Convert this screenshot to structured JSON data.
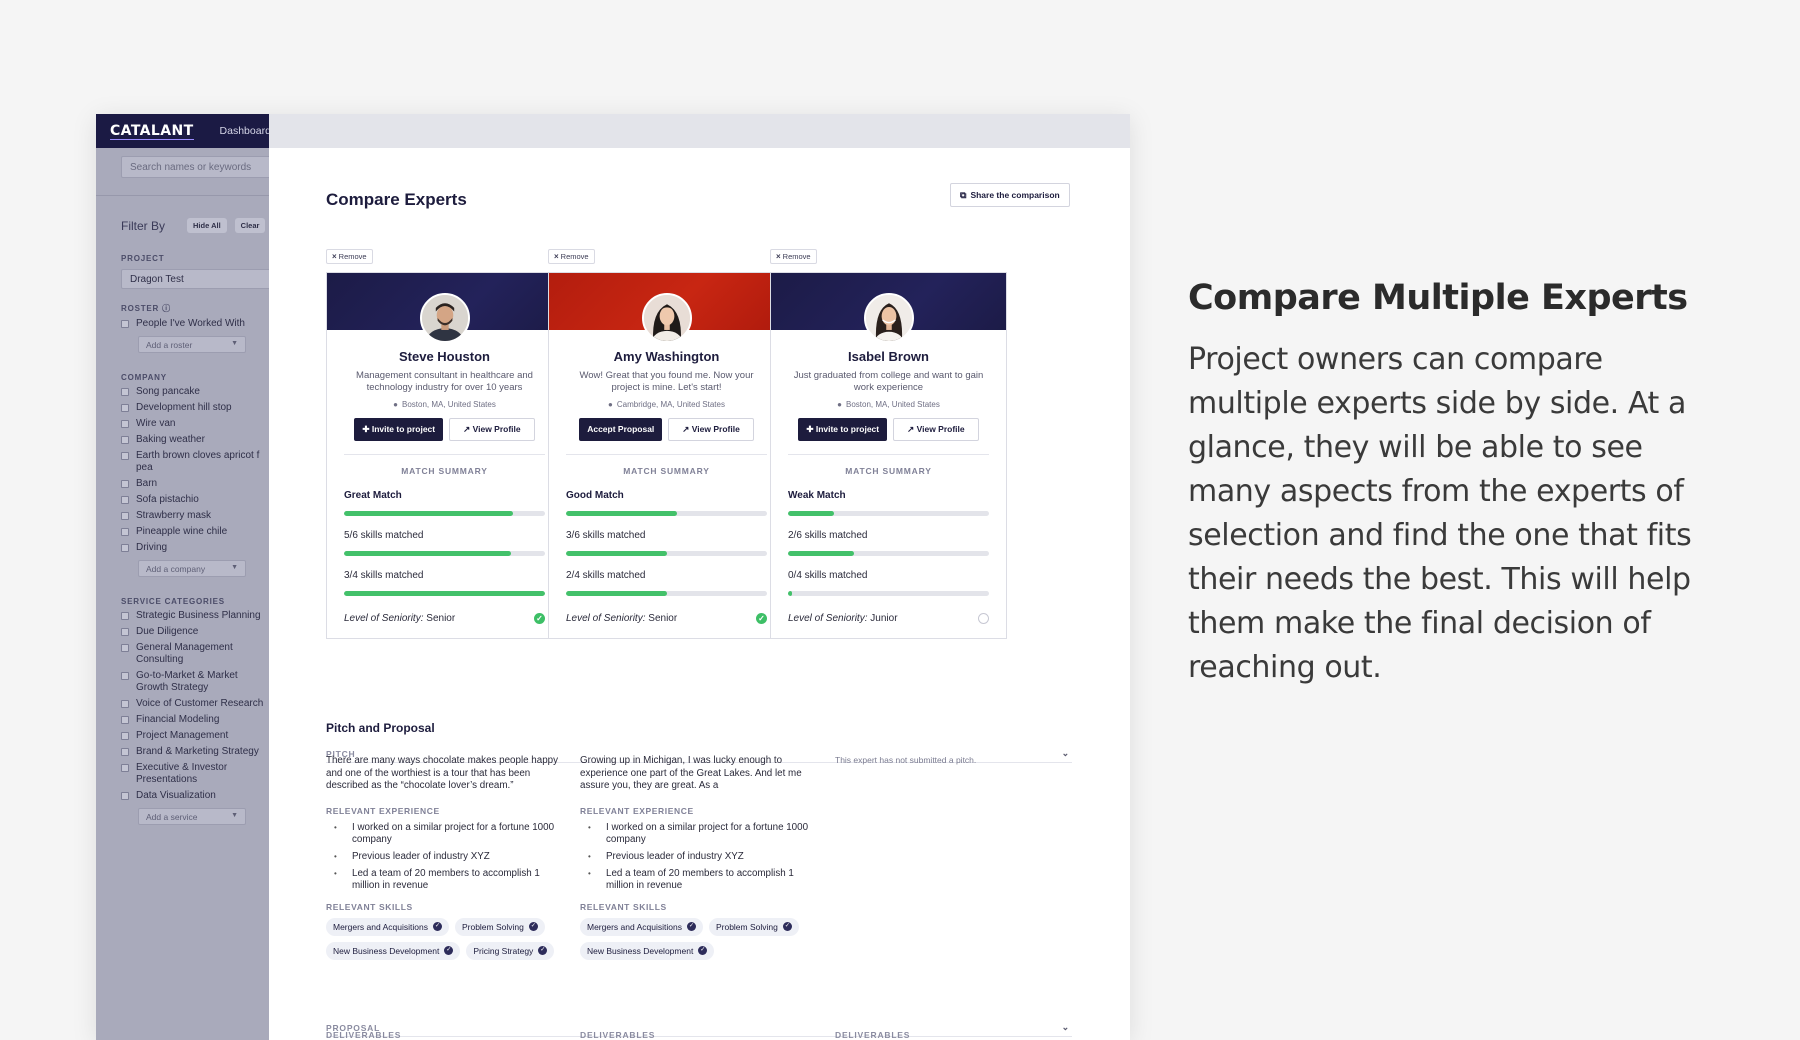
{
  "promo": {
    "title": "Compare Multiple Experts",
    "body": "Project owners can compare multiple experts side by side. At a glance, they will be able to see many aspects from the experts of selection and find the one that fits their needs the best. This will help them make the final decision of reaching out."
  },
  "app": {
    "logo": "CATALANT",
    "nav_dashboard": "Dashboard",
    "search_placeholder": "Search names or keywords"
  },
  "sidebar": {
    "filter_by": "Filter By",
    "hide_all": "Hide All",
    "clear": "Clear",
    "project_label": "PROJECT",
    "project_value": "Dragon Test",
    "roster_label": "ROSTER",
    "roster_items": [
      "People I've Worked With"
    ],
    "roster_add": "Add a roster",
    "company_label": "COMPANY",
    "company_items": [
      "Song pancake",
      "Development hill stop",
      "Wire van",
      "Baking weather",
      "Earth brown cloves apricot f pea",
      "Barn",
      "Sofa pistachio",
      "Strawberry mask",
      "Pineapple wine chile",
      "Driving"
    ],
    "company_add": "Add a company",
    "service_label": "SERVICE CATEGORIES",
    "service_items": [
      "Strategic Business Planning",
      "Due Diligence",
      "General Management Consulting",
      "Go-to-Market & Market Growth Strategy",
      "Voice of Customer Research",
      "Financial Modeling",
      "Project Management",
      "Brand & Marketing Strategy",
      "Executive & Investor Presentations",
      "Data Visualization"
    ],
    "service_add": "Add a service"
  },
  "main": {
    "title": "Compare Experts",
    "share_label": "Share the comparison",
    "remove_label": "Remove",
    "match_summary_label": "MATCH SUMMARY",
    "seniority_label": "Level of Seniority:"
  },
  "experts": [
    {
      "name": "Steve Houston",
      "bio": "Management consultant in healthcare and technology industry for over 10 years",
      "location": "Boston, MA, United States",
      "primary_action": "Invite to project",
      "secondary_action": "View Profile",
      "match_label": "Great Match",
      "match_level": 0.84,
      "skills1_label": "5/6 skills matched",
      "skills1_ratio": 0.83,
      "skills2_label": "3/4 skills matched",
      "skills2_ratio": 1.0,
      "seniority": "Senior",
      "seniority_met": true,
      "banner": "navy"
    },
    {
      "name": "Amy Washington",
      "bio": "Wow! Great that you found me. Now your project is mine. Let's start!",
      "location": "Cambridge, MA, United States",
      "primary_action": "Accept Proposal",
      "secondary_action": "View Profile",
      "match_label": "Good Match",
      "match_level": 0.55,
      "skills1_label": "3/6 skills matched",
      "skills1_ratio": 0.5,
      "skills2_label": "2/4 skills matched",
      "skills2_ratio": 0.5,
      "seniority": "Senior",
      "seniority_met": true,
      "banner": "red"
    },
    {
      "name": "Isabel Brown",
      "bio": "Just graduated from college and want to gain work experience",
      "location": "Boston, MA, United States",
      "primary_action": "Invite to project",
      "secondary_action": "View Profile",
      "match_label": "Weak Match",
      "match_level": 0.23,
      "skills1_label": "2/6 skills matched",
      "skills1_ratio": 0.33,
      "skills2_label": "0/4 skills matched",
      "skills2_ratio": 0.02,
      "seniority": "Junior",
      "seniority_met": false,
      "banner": "navy"
    }
  ],
  "pitch": {
    "section_title": "Pitch and Proposal",
    "pitch_label": "PITCH",
    "proposal_label": "PROPOSAL",
    "deliverables_label": "DELIVERABLES",
    "relevant_experience_label": "RELEVANT EXPERIENCE",
    "relevant_skills_label": "RELEVANT SKILLS",
    "col1_text": "There are many ways chocolate makes people happy and one of the worthiest is a tour that has been described as the “chocolate lover’s dream.”",
    "col2_text": "Growing up in Michigan, I was lucky enough to experience one part of the Great Lakes. And let me assure you, they are great. As a",
    "col3_text": "This expert has not submitted a pitch.",
    "experience": [
      "I worked on a similar project for a fortune 1000 company",
      "Previous leader of industry XYZ",
      "Led a team of 20 members to accomplish 1 million in revenue"
    ],
    "col1_skills": [
      "Mergers and Acquisitions",
      "Problem Solving",
      "New Business Development",
      "Pricing Strategy"
    ],
    "col2_skills": [
      "Mergers and Acquisitions",
      "Problem Solving",
      "New Business Development"
    ]
  }
}
